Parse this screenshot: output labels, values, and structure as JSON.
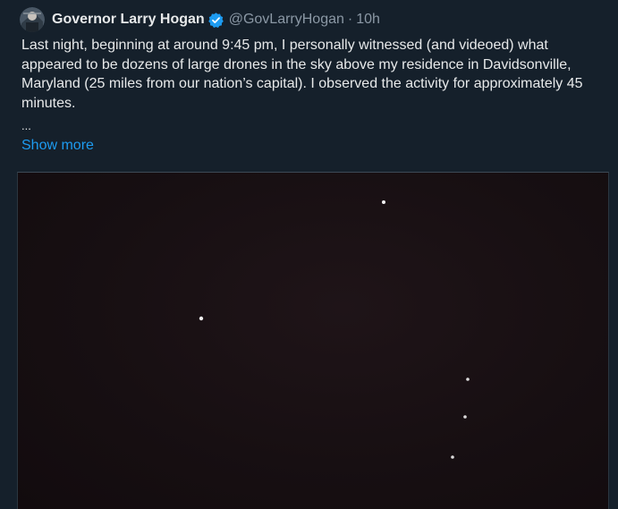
{
  "tweet": {
    "display_name": "Governor Larry Hogan",
    "verified_icon": "verified-badge-icon",
    "handle": "@GovLarryHogan",
    "separator": "·",
    "time": "10h",
    "text": "Last night, beginning at around 9:45 pm, I personally witnessed (and videoed) what appeared to be dozens of large drones in the sky above my residence in Davidsonville, Maryland (25 miles from our nation’s capital). I observed the activity for approximately 45 minutes.",
    "ellipsis": "...",
    "show_more": "Show more"
  },
  "colors": {
    "background": "#15202b",
    "text": "#e7e9ea",
    "muted": "#8b98a5",
    "link": "#1d9bf0",
    "verified": "#1d9bf0"
  },
  "media": {
    "kind": "night-sky-video-frame"
  }
}
